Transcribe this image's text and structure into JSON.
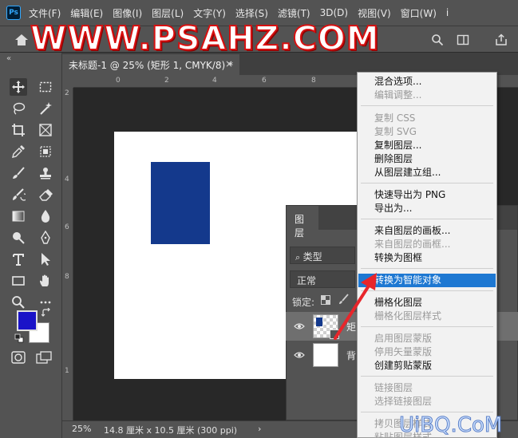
{
  "menubar": {
    "logo": "Ps",
    "items": [
      "文件(F)",
      "编辑(E)",
      "图像(I)",
      "图层(L)",
      "文字(Y)",
      "选择(S)",
      "滤镜(T)",
      "3D(D)",
      "视图(V)",
      "窗口(W)",
      "i"
    ]
  },
  "watermark": {
    "top": "WWW.PSAHZ.COM",
    "bottom": "UiBQ.CoM"
  },
  "document": {
    "tab_title": "未标题-1 @ 25% (矩形 1, CMYK/8) *",
    "close": "×",
    "rect_color": "#14398c"
  },
  "rulers": {
    "top": [
      "0",
      "2",
      "4",
      "6",
      "8"
    ],
    "left": [
      "2",
      "4",
      "6",
      "8",
      "1"
    ]
  },
  "statusbar": {
    "zoom": "25%",
    "doc_info": "14.8 厘米 x 10.5 厘米 (300 ppi)",
    "arrow": "›"
  },
  "layers_panel": {
    "tab": "图层",
    "filter": "类型",
    "blend_mode": "正常",
    "lock_label": "锁定:",
    "layers": [
      {
        "name": "矩",
        "selected": true
      },
      {
        "name": "背",
        "selected": false
      }
    ]
  },
  "context_menu": {
    "groups": [
      [
        {
          "label": "混合选项...",
          "disabled": false
        },
        {
          "label": "编辑调整...",
          "disabled": true
        }
      ],
      [
        {
          "label": "复制 CSS",
          "disabled": true
        },
        {
          "label": "复制 SVG",
          "disabled": true
        },
        {
          "label": "复制图层...",
          "disabled": false
        },
        {
          "label": "删除图层",
          "disabled": false
        },
        {
          "label": "从图层建立组...",
          "disabled": false
        }
      ],
      [
        {
          "label": "快速导出为 PNG",
          "disabled": false
        },
        {
          "label": "导出为...",
          "disabled": false
        }
      ],
      [
        {
          "label": "来自图层的画板...",
          "disabled": false
        },
        {
          "label": "来自图层的画框...",
          "disabled": true
        },
        {
          "label": "转换为图框",
          "disabled": false
        }
      ],
      [
        {
          "label": "转换为智能对象",
          "disabled": false,
          "highlight": true
        }
      ],
      [
        {
          "label": "栅格化图层",
          "disabled": false
        },
        {
          "label": "栅格化图层样式",
          "disabled": true
        }
      ],
      [
        {
          "label": "启用图层蒙版",
          "disabled": true
        },
        {
          "label": "停用矢量蒙版",
          "disabled": true
        },
        {
          "label": "创建剪贴蒙版",
          "disabled": false
        }
      ],
      [
        {
          "label": "链接图层",
          "disabled": true
        },
        {
          "label": "选择链接图层",
          "disabled": true
        }
      ],
      [
        {
          "label": "拷贝图层样式",
          "disabled": true
        },
        {
          "label": "粘贴图层样式",
          "disabled": true
        }
      ]
    ]
  },
  "colors": {
    "foreground": "#1a13c8",
    "background": "#ffffff",
    "highlight": "#1e78d2",
    "arrow": "#e8262b"
  }
}
